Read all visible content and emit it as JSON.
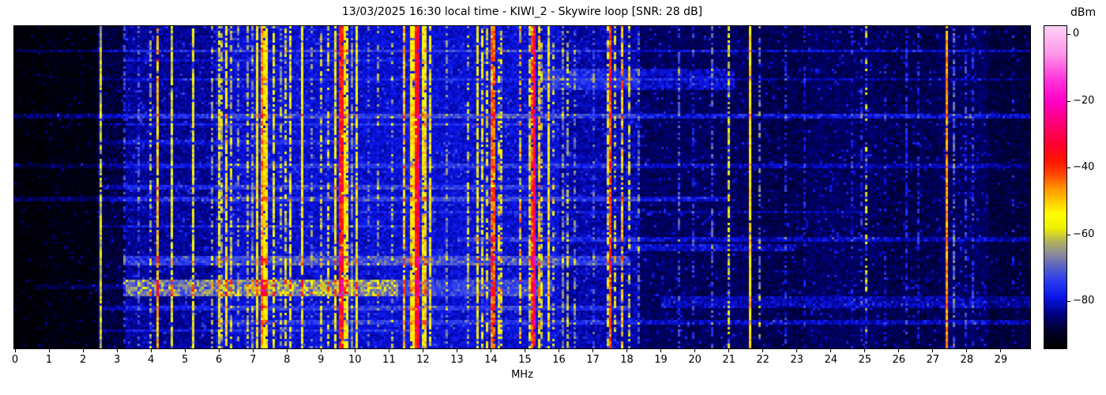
{
  "title": "13/03/2025 16:30 local time - KIWI_2 - Skywire loop [SNR: 28 dB]",
  "chart_data": {
    "type": "heatmap",
    "subtype": "radio-spectrum-waterfall",
    "title": "13/03/2025 16:30 local time - KIWI_2 - Skywire loop [SNR: 28 dB]",
    "xlabel": "MHz",
    "ylabel": "",
    "x_range_mhz": [
      0,
      29.86
    ],
    "x_ticks": [
      0,
      1,
      2,
      3,
      4,
      5,
      6,
      7,
      8,
      9,
      10,
      11,
      12,
      13,
      14,
      15,
      16,
      17,
      18,
      19,
      20,
      21,
      22,
      23,
      24,
      25,
      26,
      27,
      28,
      29
    ],
    "y_ticks": [],
    "colorbar": {
      "label": "dBm",
      "tick_values": [
        0,
        -20,
        -40,
        -60,
        -80
      ],
      "tick_labels": [
        "0",
        "−20",
        "−40",
        "−60",
        "−80"
      ],
      "vmax": 2.4,
      "vmin": -94.2
    },
    "colormap_stops": [
      [
        -94,
        "#000000"
      ],
      [
        -89,
        "#00002d"
      ],
      [
        -84,
        "#000080"
      ],
      [
        -79,
        "#0a14e6"
      ],
      [
        -74,
        "#2a3cf0"
      ],
      [
        -70,
        "#5560c8"
      ],
      [
        -66,
        "#8a8a9a"
      ],
      [
        -62,
        "#b4b45a"
      ],
      [
        -58,
        "#f0f000"
      ],
      [
        -54,
        "#ffff00"
      ],
      [
        -50,
        "#ffc800"
      ],
      [
        -46,
        "#ff9000"
      ],
      [
        -42,
        "#ff4600"
      ],
      [
        -38,
        "#ff1400"
      ],
      [
        -33,
        "#ff0032"
      ],
      [
        -27,
        "#ff0073"
      ],
      [
        -20,
        "#ff00c8"
      ],
      [
        -13,
        "#ff3cdc"
      ],
      [
        -6,
        "#ff96ea"
      ],
      [
        2.4,
        "#ffd2f5"
      ]
    ],
    "seed": 20250313,
    "noise_regions_format": "[mhz_start, mhz_end, floor_dbm, jitter_db, speckle_prob, speckle_dbm]",
    "noise_regions": [
      [
        0.0,
        0.9,
        -93,
        1.5,
        0.02,
        -86
      ],
      [
        0.9,
        2.45,
        -92,
        2.0,
        0.03,
        -85
      ],
      [
        2.45,
        3.25,
        -88,
        2.5,
        0.05,
        -82
      ],
      [
        3.25,
        5.9,
        -83,
        2.5,
        0.05,
        -76
      ],
      [
        5.9,
        9.9,
        -80,
        2.5,
        0.06,
        -74
      ],
      [
        9.9,
        11.5,
        -80,
        2.5,
        0.04,
        -75
      ],
      [
        11.5,
        12.3,
        -79,
        2.5,
        0.05,
        -74
      ],
      [
        12.3,
        16.0,
        -80,
        2.5,
        0.06,
        -74
      ],
      [
        16.0,
        18.35,
        -82,
        2.5,
        0.05,
        -76
      ],
      [
        18.35,
        21.5,
        -86,
        2.5,
        0.04,
        -79
      ],
      [
        21.5,
        23.3,
        -87,
        2.5,
        0.04,
        -80
      ],
      [
        23.3,
        25.5,
        -86,
        2.5,
        0.05,
        -79
      ],
      [
        25.5,
        27.2,
        -87,
        2.5,
        0.04,
        -80
      ],
      [
        27.2,
        28.6,
        -86,
        2.5,
        0.05,
        -79
      ],
      [
        28.6,
        29.86,
        -88,
        2.0,
        0.03,
        -82
      ]
    ],
    "signals_format": "[mhz_start, mhz_end, peak_dbm, duty_cycle]",
    "signals": [
      [
        2.48,
        2.56,
        -62,
        0.95
      ],
      [
        3.2,
        3.26,
        -74,
        0.5
      ],
      [
        3.6,
        3.66,
        -72,
        0.4
      ],
      [
        3.94,
        4.01,
        -64,
        0.5
      ],
      [
        4.18,
        4.26,
        -50,
        0.9
      ],
      [
        4.6,
        4.67,
        -58,
        0.85
      ],
      [
        5.2,
        5.28,
        -57,
        0.85
      ],
      [
        5.74,
        5.8,
        -66,
        0.5
      ],
      [
        5.95,
        6.02,
        -58,
        0.8
      ],
      [
        6.06,
        6.12,
        -62,
        0.6
      ],
      [
        6.16,
        6.23,
        -55,
        0.85
      ],
      [
        6.3,
        6.37,
        -62,
        0.6
      ],
      [
        6.55,
        6.61,
        -66,
        0.5
      ],
      [
        6.78,
        6.85,
        -63,
        0.55
      ],
      [
        6.95,
        7.02,
        -67,
        0.7
      ],
      [
        7.08,
        7.16,
        -56,
        0.9
      ],
      [
        7.2,
        7.46,
        -53,
        0.95
      ],
      [
        7.24,
        7.32,
        -46,
        0.85
      ],
      [
        7.55,
        7.62,
        -58,
        0.7
      ],
      [
        7.78,
        7.84,
        -64,
        0.5
      ],
      [
        7.95,
        8.02,
        -60,
        0.6
      ],
      [
        8.08,
        8.15,
        -58,
        0.7
      ],
      [
        8.42,
        8.5,
        -55,
        0.9
      ],
      [
        8.7,
        8.76,
        -66,
        0.4
      ],
      [
        8.95,
        9.02,
        -62,
        0.5
      ],
      [
        9.15,
        9.22,
        -60,
        0.5
      ],
      [
        9.38,
        9.46,
        -55,
        0.85
      ],
      [
        9.5,
        9.68,
        -38,
        0.95
      ],
      [
        9.7,
        9.78,
        -54,
        0.8
      ],
      [
        9.86,
        9.94,
        -68,
        0.85
      ],
      [
        10.0,
        10.08,
        -56,
        0.9
      ],
      [
        10.35,
        10.42,
        -70,
        0.4
      ],
      [
        10.65,
        10.72,
        -66,
        0.4
      ],
      [
        11.07,
        11.14,
        -63,
        0.4
      ],
      [
        11.38,
        11.45,
        -50,
        0.85
      ],
      [
        11.6,
        11.73,
        -54,
        0.9
      ],
      [
        11.76,
        11.92,
        -37,
        0.95
      ],
      [
        11.81,
        11.87,
        -33,
        0.8
      ],
      [
        11.96,
        12.12,
        -52,
        0.9
      ],
      [
        12.16,
        12.24,
        -58,
        0.8
      ],
      [
        12.68,
        12.76,
        -68,
        0.5
      ],
      [
        13.28,
        13.35,
        -62,
        0.45
      ],
      [
        13.56,
        13.64,
        -56,
        0.85
      ],
      [
        13.7,
        13.78,
        -58,
        0.7
      ],
      [
        13.84,
        13.91,
        -60,
        0.6
      ],
      [
        14.0,
        14.12,
        -44,
        0.9
      ],
      [
        14.2,
        14.36,
        -57,
        0.45
      ],
      [
        14.85,
        14.93,
        -46,
        0.3
      ],
      [
        15.08,
        15.16,
        -58,
        0.7
      ],
      [
        15.18,
        15.26,
        -42,
        0.85
      ],
      [
        15.27,
        15.34,
        -30,
        0.92
      ],
      [
        15.37,
        15.44,
        -50,
        0.7
      ],
      [
        15.47,
        15.55,
        -62,
        0.6
      ],
      [
        15.68,
        15.76,
        -56,
        0.9
      ],
      [
        15.8,
        15.88,
        -60,
        0.3
      ],
      [
        16.1,
        16.17,
        -68,
        0.7
      ],
      [
        16.25,
        16.32,
        -64,
        0.6
      ],
      [
        16.4,
        16.48,
        -68,
        0.5
      ],
      [
        17.0,
        17.07,
        -71,
        0.4
      ],
      [
        17.42,
        17.49,
        -58,
        0.6
      ],
      [
        17.5,
        17.58,
        -42,
        0.95
      ],
      [
        17.62,
        17.7,
        -60,
        0.5
      ],
      [
        17.8,
        17.88,
        -50,
        0.65
      ],
      [
        18.03,
        18.1,
        -60,
        0.6
      ],
      [
        18.3,
        18.4,
        -70,
        0.5
      ],
      [
        19.5,
        19.58,
        -72,
        0.5
      ],
      [
        19.95,
        20.02,
        -75,
        0.4
      ],
      [
        20.48,
        20.55,
        -72,
        0.5
      ],
      [
        20.98,
        21.06,
        -58,
        0.5
      ],
      [
        21.57,
        21.65,
        -54,
        0.97
      ],
      [
        21.9,
        21.97,
        -68,
        0.45
      ],
      [
        22.62,
        22.69,
        -76,
        0.5
      ],
      [
        23.2,
        23.27,
        -79,
        0.4
      ],
      [
        24.6,
        24.66,
        -78,
        0.4
      ],
      [
        24.88,
        24.95,
        -76,
        0.5
      ],
      [
        25.02,
        25.1,
        -60,
        0.3
      ],
      [
        25.55,
        25.62,
        -79,
        0.35
      ],
      [
        26.2,
        26.27,
        -77,
        0.5
      ],
      [
        26.55,
        26.62,
        -77,
        0.45
      ],
      [
        27.38,
        27.46,
        -47,
        0.95
      ],
      [
        27.56,
        27.63,
        -70,
        0.6
      ],
      [
        27.95,
        28.02,
        -75,
        0.45
      ],
      [
        28.15,
        28.22,
        -75,
        0.45
      ],
      [
        29.3,
        29.37,
        -79,
        0.3
      ]
    ],
    "time_events_format": "[y_frac_start, y_frac_end, mhz_start, mhz_end, boost_db]",
    "time_events": [
      [
        0.07,
        0.082,
        0,
        29.86,
        7
      ],
      [
        0.1,
        0.11,
        3.2,
        12,
        4
      ],
      [
        0.132,
        0.196,
        15.5,
        21.2,
        6
      ],
      [
        0.16,
        0.17,
        2.5,
        29.86,
        4
      ],
      [
        0.275,
        0.287,
        0,
        29.86,
        8
      ],
      [
        0.3,
        0.31,
        2.5,
        16,
        5
      ],
      [
        0.355,
        0.365,
        2.5,
        10,
        4
      ],
      [
        0.43,
        0.442,
        0,
        29.86,
        5
      ],
      [
        0.495,
        0.51,
        2.5,
        16,
        6
      ],
      [
        0.528,
        0.545,
        0,
        21,
        7
      ],
      [
        0.57,
        0.58,
        10,
        25,
        4
      ],
      [
        0.615,
        0.625,
        2.5,
        12,
        5
      ],
      [
        0.655,
        0.67,
        13,
        29.86,
        6
      ],
      [
        0.68,
        0.7,
        18,
        23,
        6
      ],
      [
        0.71,
        0.745,
        3.2,
        18,
        9
      ],
      [
        0.79,
        0.835,
        3.2,
        11.3,
        16
      ],
      [
        0.79,
        0.835,
        11.3,
        15.8,
        7
      ],
      [
        0.8,
        0.815,
        0.5,
        3.2,
        5
      ],
      [
        0.84,
        0.875,
        19,
        29.86,
        5
      ],
      [
        0.87,
        0.882,
        2.5,
        18,
        6
      ],
      [
        0.915,
        0.928,
        6,
        29.86,
        6
      ],
      [
        0.94,
        0.952,
        2.5,
        12,
        5
      ]
    ]
  }
}
